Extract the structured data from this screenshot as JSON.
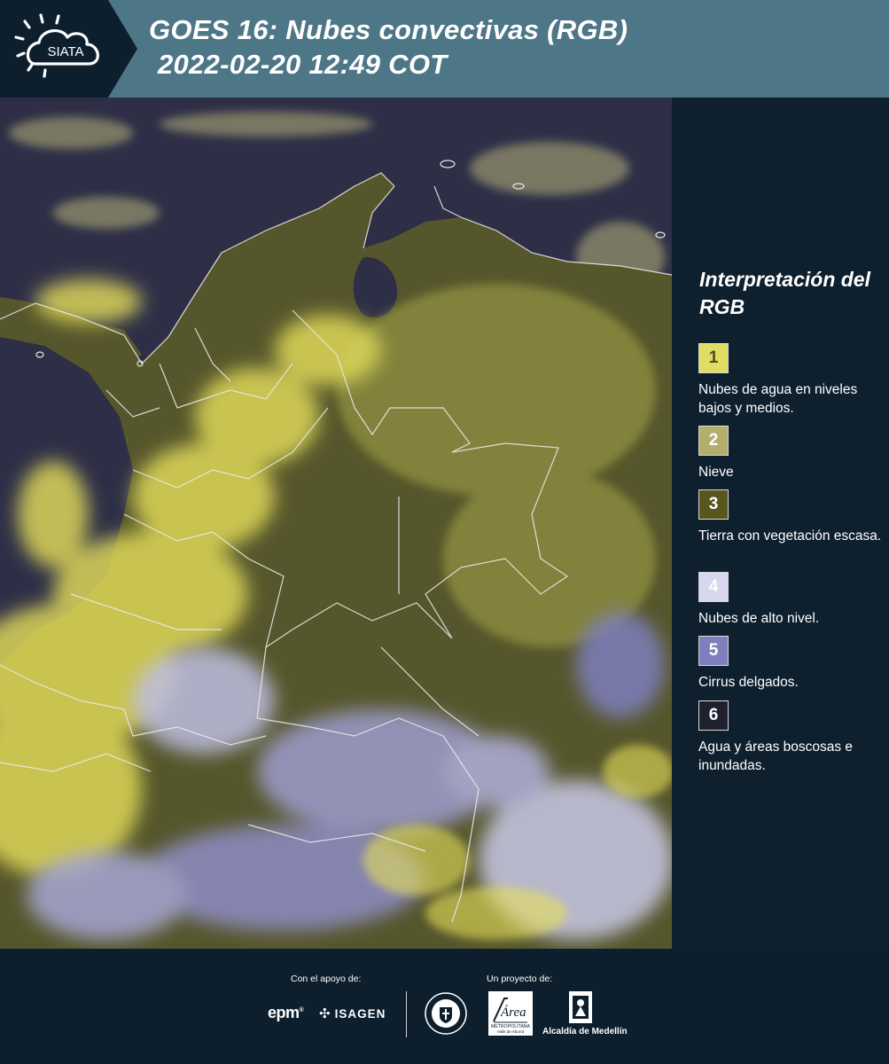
{
  "header": {
    "brand": "SIATA",
    "title_line1": "GOES 16: Nubes convectivas (RGB)",
    "title_line2": "2022-02-20 12:49 COT"
  },
  "map": {
    "colors": {
      "ocean": "#2e2f47",
      "land_vegetation": "#5a5a2a",
      "low_mid_clouds": "#e8e35a",
      "high_clouds": "#d9daf2",
      "thin_cirrus": "#8a89c4",
      "borders": "#e8e8e8"
    }
  },
  "legend": {
    "title": "Interpretación del RGB",
    "items": [
      {
        "number": "1",
        "label": "Nubes de agua en niveles bajos y medios.",
        "color": "#e1dd63",
        "num_color": "#4a4a1a"
      },
      {
        "number": "2",
        "label": "Nieve",
        "color": "#b3ae6c",
        "num_color": "#ffffff"
      },
      {
        "number": "3",
        "label": "Tierra con vegetación escasa.",
        "color": "#58551f",
        "num_color": "#ffffff"
      },
      {
        "number": "4",
        "label": "Nubes de alto nivel.",
        "color": "#d6d6ef",
        "num_color": "#ffffff"
      },
      {
        "number": "5",
        "label": "Cirrus delgados.",
        "color": "#7f7fbd",
        "num_color": "#ffffff"
      },
      {
        "number": "6",
        "label": "Agua y áreas boscosas e inundadas.",
        "color": "#20212f",
        "num_color": "#ffffff"
      }
    ]
  },
  "footer": {
    "support_caption": "Con el apoyo de:",
    "project_caption": "Un proyecto de:",
    "sponsors": [
      "epm",
      "ISAGEN"
    ],
    "partners": [
      "MEDELLÍN",
      "Área METROPOLITANA Valle de Aburrá",
      "Alcaldía de Medellín"
    ],
    "epm_label": "epm",
    "isagen_label": "ISAGEN",
    "area_label": "Área",
    "area_sub1": "METROPOLITANA",
    "area_sub2": "Valle de Aburrá",
    "alcaldia_label": "Alcaldía de Medellín"
  }
}
